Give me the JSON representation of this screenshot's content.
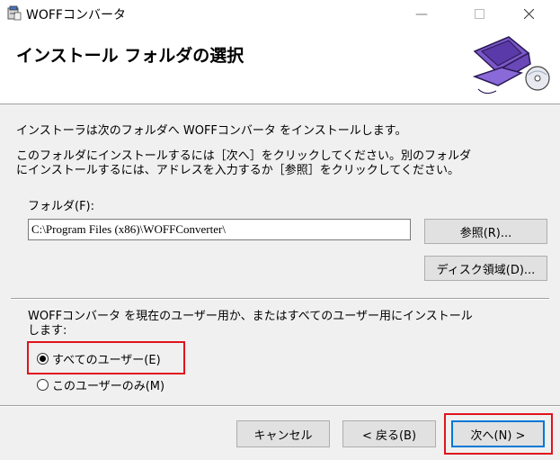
{
  "window": {
    "title": "WOFFコンバータ",
    "minimize_icon": "minimize-icon",
    "maximize_icon": "maximize-icon",
    "close_icon": "close-icon"
  },
  "header": {
    "title": "インストール フォルダの選択",
    "art_icon": "computer-setup-icon"
  },
  "body": {
    "intro": "インストーラは次のフォルダへ WOFFコンバータ をインストールします。",
    "instructions_line1": "このフォルダにインストールするには［次へ］をクリックしてください。別のフォルダ",
    "instructions_line2": "にインストールするには、アドレスを入力するか［参照］をクリックしてください。",
    "folder_label": "フォルダ(F):",
    "folder_value": "C:\\Program Files (x86)\\WOFFConverter\\",
    "browse_button": "参照(R)...",
    "disk_button": "ディスク領域(D)...",
    "users_prompt_line1": "WOFFコンバータ を現在のユーザー用か、またはすべてのユーザー用にインストール",
    "users_prompt_line2": "します:",
    "radio_all_users": "すべてのユーザー(E)",
    "radio_this_user": "このユーザーのみ(M)",
    "selected_option": "all_users"
  },
  "footer": {
    "cancel_button": "キャンセル",
    "back_button": "< 戻る(B)",
    "next_button": "次へ(N) >"
  },
  "colors": {
    "highlight": "#e0131e",
    "default_button_border": "#0078d7"
  }
}
